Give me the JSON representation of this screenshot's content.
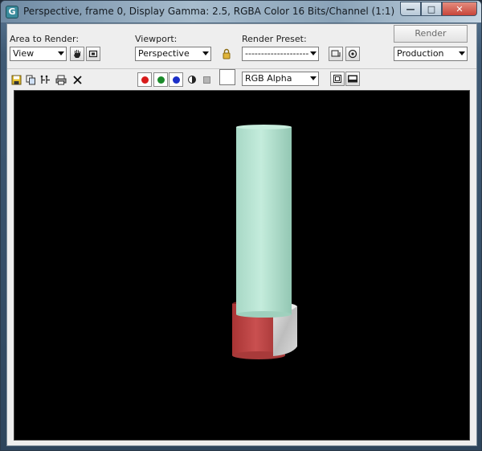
{
  "window": {
    "title": "Perspective, frame 0, Display Gamma: 2.5, RGBA Color 16 Bits/Channel (1:1)",
    "app_icon_glyph": "G",
    "controls": {
      "minimize": "—",
      "maximize": "□",
      "close": "✕"
    }
  },
  "toolbar": {
    "area_label": "Area to Render:",
    "area_value": "View",
    "viewport_label": "Viewport:",
    "viewport_value": "Perspective",
    "preset_label": "Render Preset:",
    "preset_value": "--------------------",
    "render_button": "Render",
    "production_value": "Production",
    "channel_value": "RGB Alpha"
  },
  "channels": {
    "red": "#d81b1b",
    "green": "#1a8a2a",
    "blue": "#1b2fc8"
  },
  "colors": {
    "viewport_bg": "#000000",
    "cylinder_top": "#b9e4d4",
    "cylinder_base": "#c24b4b",
    "box": "#d0d0d0"
  },
  "icons": [
    "pan-icon",
    "region-icon",
    "lock-icon",
    "preset-save-icon",
    "preset-options-icon",
    "save-icon",
    "clone-icon",
    "copy-icon",
    "print-icon",
    "clear-icon",
    "mono-icon",
    "alpha-icon",
    "display-icon",
    "toggle-ui-icon"
  ]
}
